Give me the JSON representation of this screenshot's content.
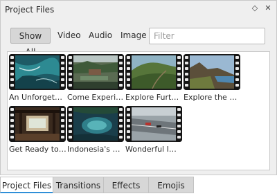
{
  "panel": {
    "title": "Project Files",
    "float_icon": "◇",
    "close_icon": "✕"
  },
  "filters": {
    "buttons": [
      "Show All",
      "Video",
      "Audio",
      "Image"
    ],
    "active": "Show All",
    "search_placeholder": "Filter"
  },
  "files": [
    {
      "label": "An Unforget…",
      "scene": "ocean"
    },
    {
      "label": "Come Experi…",
      "scene": "resort"
    },
    {
      "label": "Explore Furt…",
      "scene": "hills"
    },
    {
      "label": "Explore the …",
      "scene": "coast"
    },
    {
      "label": "Get Ready to…",
      "scene": "pavilion"
    },
    {
      "label": "Indonesia's …",
      "scene": "lagoon"
    },
    {
      "label": "Wonderful I…",
      "scene": "racetrack"
    }
  ],
  "tabs": {
    "items": [
      "Project Files",
      "Transitions",
      "Effects",
      "Emojis"
    ],
    "active": "Project Files"
  },
  "colors": {
    "tab_accent": "#2f8fd8"
  }
}
